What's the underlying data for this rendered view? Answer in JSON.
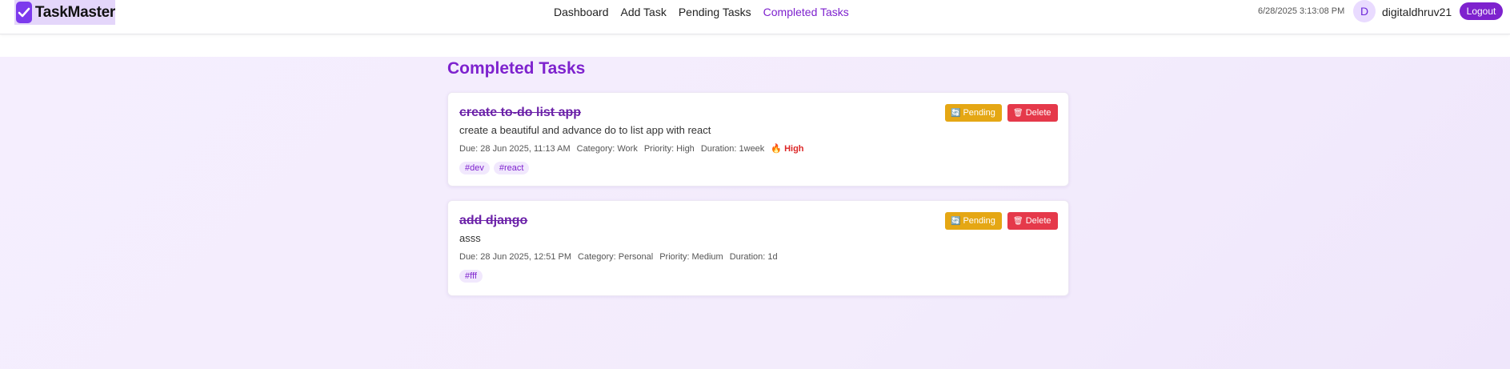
{
  "app": {
    "name": "TaskMaster",
    "logo_icon": "check-square-icon"
  },
  "nav": {
    "links": [
      "Dashboard",
      "Add Task",
      "Pending Tasks",
      "Completed Tasks"
    ],
    "active": "Completed Tasks"
  },
  "header": {
    "datetime": "6/28/2025 3:13:08 PM",
    "avatar_initial": "D",
    "username": "digitaldhruv21",
    "logout_label": "Logout"
  },
  "page": {
    "title": "Completed Tasks"
  },
  "tasks": [
    {
      "title": "create to-do list app",
      "description": "create a beautiful and advance do to list app with react",
      "due": "Due: 28 Jun 2025, 11:13 AM",
      "category": "Category: Work",
      "priority": "Priority: High",
      "duration": "Duration: 1week",
      "flag": "High",
      "tags": [
        "#dev",
        "#react"
      ],
      "pending_label": "Pending",
      "delete_label": "Delete"
    },
    {
      "title": "add django",
      "description": "asss",
      "due": "Due: 28 Jun 2025, 12:51 PM",
      "category": "Category: Personal",
      "priority": "Priority: Medium",
      "duration": "Duration: 1d",
      "tags": [
        "#fff"
      ],
      "pending_label": "Pending",
      "delete_label": "Delete"
    }
  ],
  "colors": {
    "brand": "#7e22ce",
    "pending_button": "#e5a714",
    "delete_button": "#e5394a",
    "high_priority": "#dc2626"
  }
}
